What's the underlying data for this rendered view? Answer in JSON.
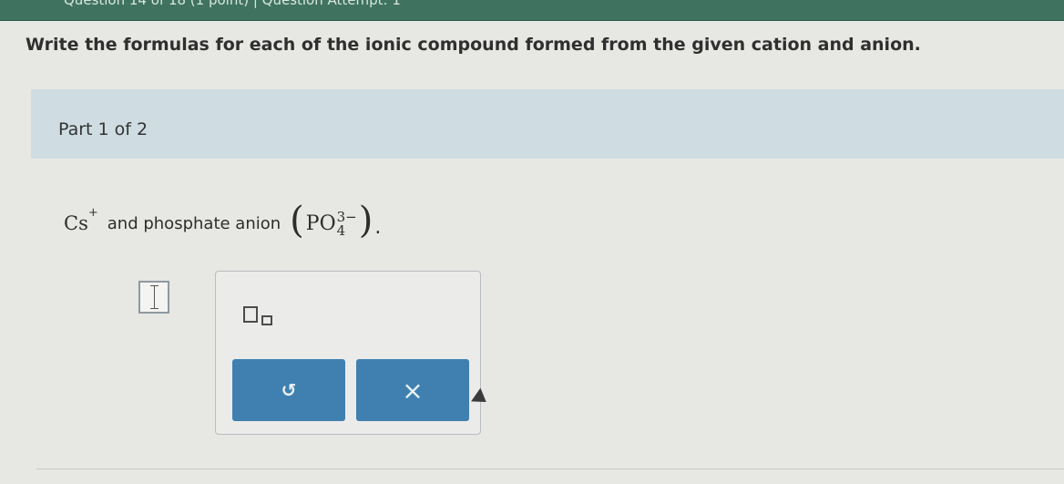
{
  "top_bar": {
    "text": "Question 14 of 18 (1 point)  |  Question Attempt: 1"
  },
  "prompt": {
    "text": "Write the formulas for each of the ionic compound formed from the given cation and anion."
  },
  "part": {
    "label": "Part 1 of 2"
  },
  "question": {
    "cation_symbol": "Cs",
    "cation_charge": "+",
    "connector": "and phosphate anion",
    "open_paren": "(",
    "anion_symbol": "PO",
    "anion_charge": "3−",
    "anion_subscript": "4",
    "close_paren": ")",
    "end_mark": "."
  },
  "toolbox": {
    "undo_glyph": "↺",
    "clear_glyph": "×"
  }
}
